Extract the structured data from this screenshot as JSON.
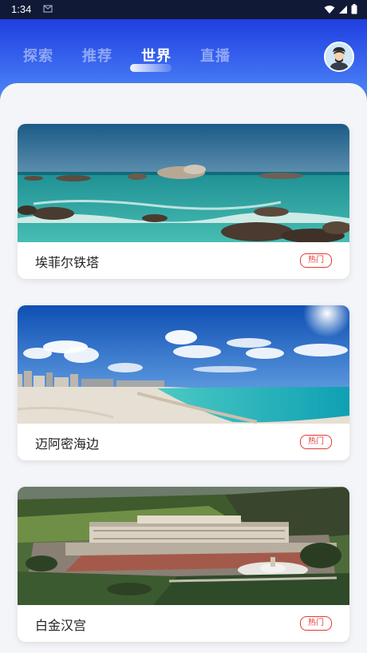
{
  "status_bar": {
    "time": "1:34"
  },
  "tabs": [
    {
      "label": "探索",
      "active": false
    },
    {
      "label": "推荐",
      "active": false
    },
    {
      "label": "世界",
      "active": true
    },
    {
      "label": "直播",
      "active": false
    }
  ],
  "colors": {
    "header_gradient_top": "#1f3fe0",
    "header_gradient_bottom": "#5aa2f7",
    "badge_red": "#e53935",
    "background": "#f4f5f8"
  },
  "cards": [
    {
      "title": "埃菲尔铁塔",
      "badge": "热门",
      "image": "beach-rocks-photo"
    },
    {
      "title": "迈阿密海边",
      "badge": "热门",
      "image": "miami-beach-photo"
    },
    {
      "title": "白金汉宫",
      "badge": "热门",
      "image": "buckingham-palace-photo"
    }
  ]
}
